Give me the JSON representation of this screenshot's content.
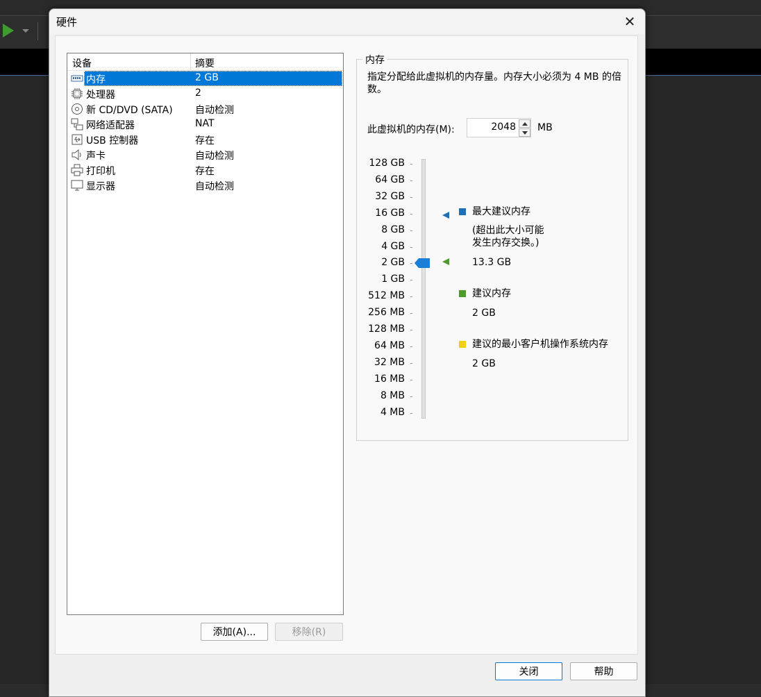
{
  "dialog": {
    "title": "硬件",
    "close_label": "关闭",
    "help_label": "帮助"
  },
  "device_list": {
    "col_device": "设备",
    "col_summary": "摘要",
    "rows": [
      {
        "name": "内存",
        "summary": "2 GB",
        "icon": "memory-icon"
      },
      {
        "name": "处理器",
        "summary": "2",
        "icon": "cpu-icon"
      },
      {
        "name": "新 CD/DVD (SATA)",
        "summary": "自动检测",
        "icon": "disc-icon"
      },
      {
        "name": "网络适配器",
        "summary": "NAT",
        "icon": "network-icon"
      },
      {
        "name": "USB 控制器",
        "summary": "存在",
        "icon": "usb-icon"
      },
      {
        "name": "声卡",
        "summary": "自动检测",
        "icon": "speaker-icon"
      },
      {
        "name": "打印机",
        "summary": "存在",
        "icon": "printer-icon"
      },
      {
        "name": "显示器",
        "summary": "自动检测",
        "icon": "monitor-icon"
      }
    ],
    "add_label": "添加(A)...",
    "remove_label": "移除(R)"
  },
  "memory": {
    "group_title": "内存",
    "description": "指定分配给此虚拟机的内存量。内存大小必须为 4 MB 的倍数。",
    "field_label": "此虚拟机的内存(M):",
    "value": "2048",
    "unit": "MB",
    "scale": [
      "128 GB",
      "64 GB",
      "32 GB",
      "16 GB",
      "8 GB",
      "4 GB",
      "2 GB",
      "1 GB",
      "512 MB",
      "256 MB",
      "128 MB",
      "64 MB",
      "32 MB",
      "16 MB",
      "8 MB",
      "4 MB"
    ],
    "max_recommended": {
      "label": "最大建议内存",
      "note_line1": "(超出此大小可能",
      "note_line2": "发生内存交换。)",
      "value": "13.3 GB",
      "color": "#1e6fb5"
    },
    "recommended": {
      "label": "建议内存",
      "value": "2 GB",
      "color": "#4e9a2a"
    },
    "min_guest": {
      "label": "建议的最小客户机操作系统内存",
      "value": "2 GB",
      "color": "#f2d20a"
    }
  }
}
